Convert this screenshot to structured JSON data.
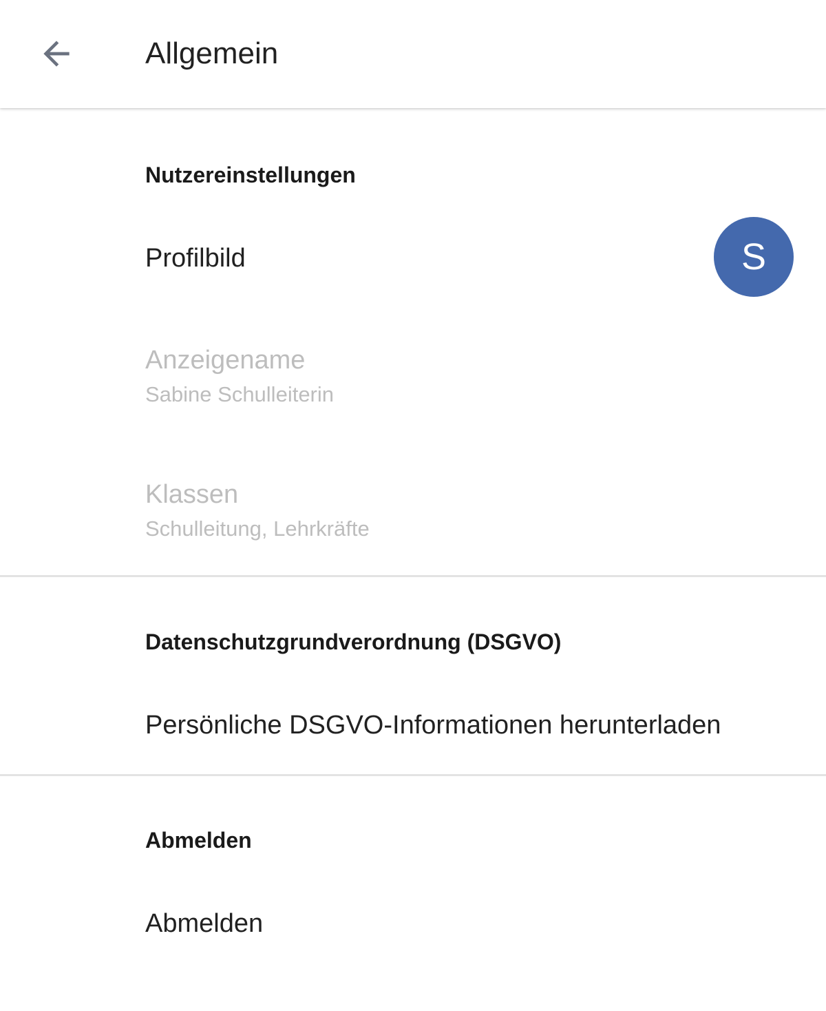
{
  "app_bar": {
    "title": "Allgemein",
    "back_icon": "arrow-back-icon"
  },
  "sections": {
    "user_settings": {
      "header": "Nutzereinstellungen",
      "profile_picture": {
        "label": "Profilbild",
        "avatar_letter": "S",
        "avatar_color": "#4469ad"
      },
      "display_name": {
        "label": "Anzeigename",
        "value": "Sabine Schulleiterin"
      },
      "classes": {
        "label": "Klassen",
        "value": "Schulleitung, Lehrkräfte"
      }
    },
    "gdpr": {
      "header": "Datenschutzgrundverordnung (DSGVO)",
      "download_label": "Persönliche DSGVO-Informationen herunterladen"
    },
    "logout": {
      "header": "Abmelden",
      "logout_label": "Abmelden"
    }
  },
  "colors": {
    "text_primary": "#212121",
    "text_disabled": "#bdbdbd",
    "divider": "#e3e3e3",
    "icon": "#6b7280"
  }
}
